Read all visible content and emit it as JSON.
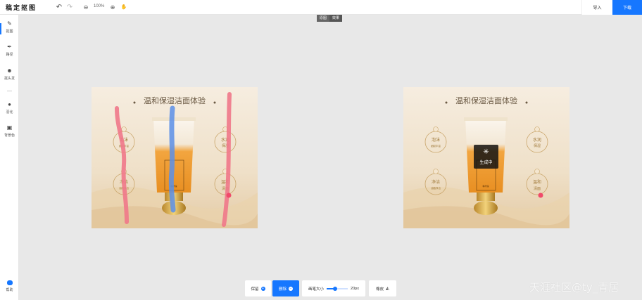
{
  "app": {
    "title": "稿定抠图"
  },
  "toolbar": {
    "zoom": "100%",
    "import_label": "导入",
    "download_label": "下载"
  },
  "sidebar": {
    "items": [
      {
        "label": "抠图",
        "icon": "brush-icon",
        "active": true
      },
      {
        "label": "路径",
        "icon": "pen-icon"
      },
      {
        "label": "抠头发",
        "icon": "hair-icon"
      },
      {
        "label": "羽化",
        "icon": "feather-icon"
      },
      {
        "label": "背景色",
        "icon": "background-icon"
      }
    ],
    "help_label": "帮助"
  },
  "compare": {
    "original": "原图",
    "result": "效果"
  },
  "poster": {
    "title": "温和保湿洁面体验",
    "badges_left": [
      {
        "big": "泡沫",
        "small": "细腻丰富"
      },
      {
        "big": "净洁",
        "small": "油脂净出"
      }
    ],
    "badges_right": [
      {
        "big": "水润",
        "small": "保湿"
      },
      {
        "big": "温和",
        "small": "清面"
      }
    ],
    "tube_label": "精华露"
  },
  "loading": {
    "text": "生成中"
  },
  "bottom_tools": {
    "keep_label": "保留",
    "remove_label": "删除",
    "brush_size_label": "画笔大小",
    "brush_size_value": "20px",
    "brush_size_fraction": 0.4,
    "eraser_label": "橡皮"
  },
  "watermark": "天涯社区@ty_青居",
  "colors": {
    "accent": "#1677ff",
    "keep_stroke": "#f0788a",
    "remove_stroke": "#5b8fe8"
  }
}
